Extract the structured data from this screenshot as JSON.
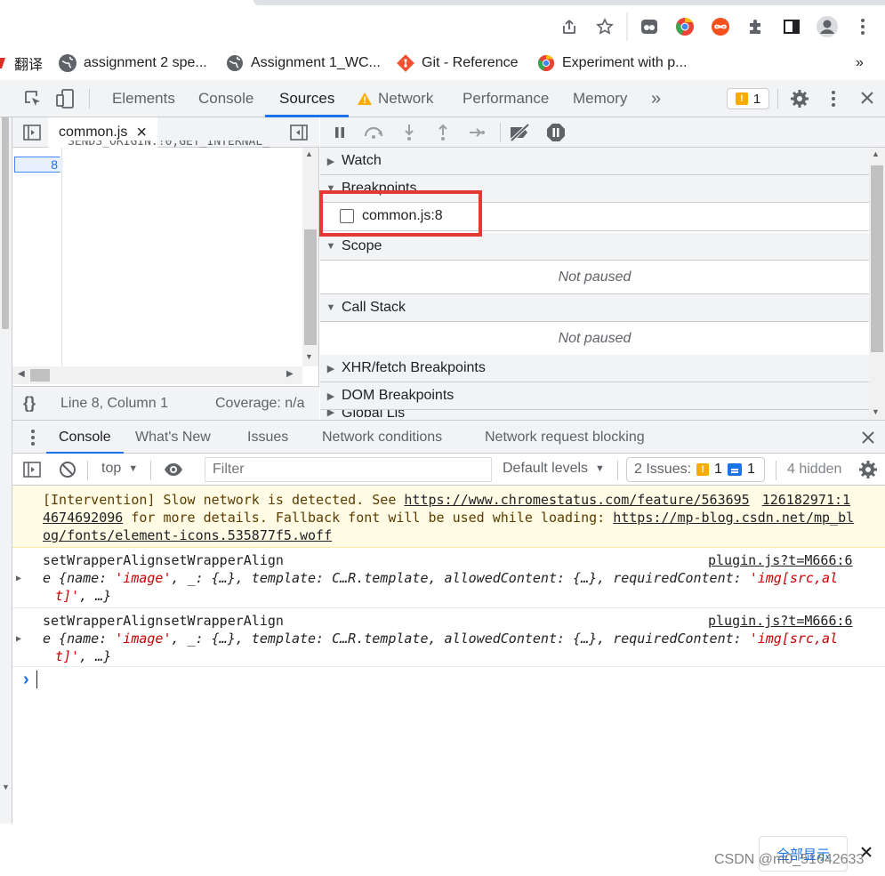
{
  "bookmarks": [
    {
      "label": "翻译"
    },
    {
      "label": "assignment 2 spe..."
    },
    {
      "label": "Assignment 1_WC..."
    },
    {
      "label": "Git - Reference"
    },
    {
      "label": "Experiment with p..."
    }
  ],
  "bookmarks_more": "»",
  "devtools": {
    "tabs": [
      "Elements",
      "Console",
      "Sources",
      "Network",
      "Performance",
      "Memory"
    ],
    "active_tab": "Sources",
    "more_tabs": "»",
    "issues_badge_count": "1"
  },
  "sources": {
    "open_file": "common.js",
    "close_glyph": "×",
    "code_line_text": "SENDS_ORIGIN:!0,GET_INTERNAL_",
    "breakpoint_line_number": "8",
    "braces": "{}",
    "cursor_position": "Line 8, Column 1",
    "coverage": "Coverage: n/a"
  },
  "debugger": {
    "sections": {
      "watch": "Watch",
      "breakpoints": "Breakpoints",
      "scope": "Scope",
      "call_stack": "Call Stack",
      "xhr": "XHR/fetch Breakpoints",
      "dom": "DOM Breakpoints",
      "global": "Global Lis"
    },
    "breakpoint_item": "common.js:8",
    "breakpoint_checked": false,
    "scope_status": "Not paused",
    "callstack_status": "Not paused",
    "highlight_color": "#e53935"
  },
  "drawer": {
    "tabs": [
      "Console",
      "What's New",
      "Issues",
      "Network conditions",
      "Network request blocking"
    ],
    "active_tab": "Console"
  },
  "console_toolbar": {
    "context": "top",
    "filter_placeholder": "Filter",
    "levels": "Default levels",
    "issues_label": "2 Issues:",
    "issues_warn_count": "1",
    "issues_info_count": "1",
    "hidden": "4 hidden"
  },
  "console_messages": {
    "warning": {
      "text_before_link": "[Intervention] Slow network is detected. See ",
      "link1": "https://www.chromestatus.com/feature/563695",
      "link2_start": "126182971:1",
      "line2_link": "4674692096",
      "line2_text": " for more details. Fallback font will be used while loading: ",
      "link3_part1": "https://mp-blog.csdn.net/mp_bl",
      "link3_part2": "og/fonts/element-icons.535877f5.woff"
    },
    "logs": [
      {
        "title": "setWrapperAlignsetWrapperAlign",
        "source": "plugin.js?t=M666:6",
        "obj_prefix": "e {name: ",
        "obj_name_val": "'image'",
        "obj_middle": ", _: {…}, template: C…R.template, allowedContent: {…}, requiredContent: ",
        "obj_req_val1": "'img[src,al",
        "obj_req_val2": "t]'",
        "obj_suffix": ", …}"
      },
      {
        "title": "setWrapperAlignsetWrapperAlign",
        "source": "plugin.js?t=M666:6",
        "obj_prefix": "e {name: ",
        "obj_name_val": "'image'",
        "obj_middle": ", _: {…}, template: C…R.template, allowedContent: {…}, requiredContent: ",
        "obj_req_val1": "'img[src,al",
        "obj_req_val2": "t]'",
        "obj_suffix": ", …}"
      }
    ],
    "prompt": "›"
  },
  "footer": {
    "show_all_button": "全部显示",
    "watermark": "CSDN @m0_51642633"
  }
}
